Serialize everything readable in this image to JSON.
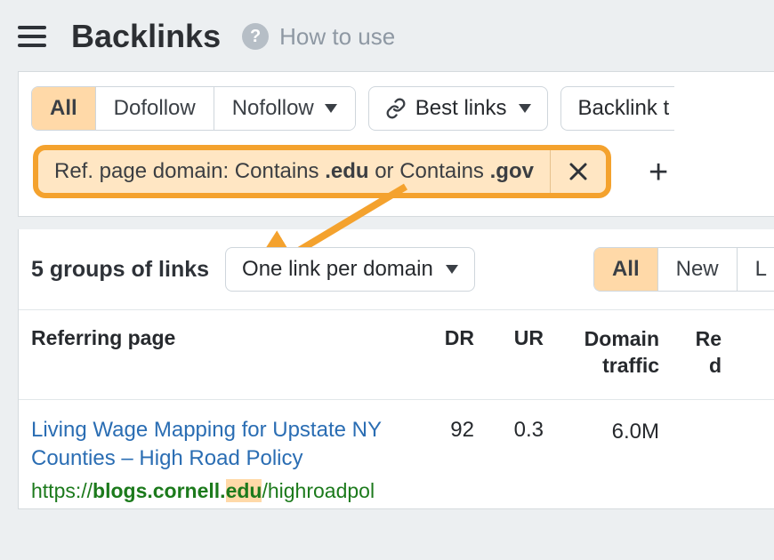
{
  "header": {
    "title": "Backlinks",
    "help_label": "How to use"
  },
  "filters": {
    "follow_tabs": [
      "All",
      "Dofollow",
      "Nofollow"
    ],
    "best_links": "Best links",
    "backlink_extra": "Backlink t",
    "applied": {
      "prefix": "Ref. page domain: Contains ",
      "v1": ".edu",
      "sep": " or Contains ",
      "v2": ".gov"
    }
  },
  "results": {
    "count_label": "5 groups of links",
    "grouping": "One link per domain",
    "status_tabs": [
      "All",
      "New",
      "L"
    ]
  },
  "columns": {
    "ref": "Referring page",
    "dr": "DR",
    "ur": "UR",
    "dt": "Domain traffic",
    "rd": "Re d"
  },
  "row": {
    "title": "Living Wage Mapping for Upstate NY Counties – High Road Policy",
    "url_pre": "https://",
    "url_bold_a": "blogs.cornell.",
    "url_bold_hl": "edu",
    "url_rest": "/highroadpol",
    "dr": "92",
    "ur": "0.3",
    "dt": "6.0M"
  }
}
